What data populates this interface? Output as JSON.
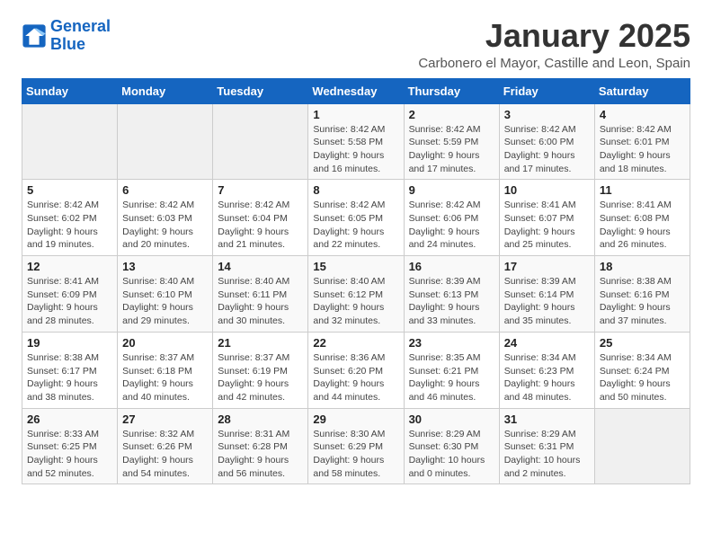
{
  "logo": {
    "line1": "General",
    "line2": "Blue"
  },
  "title": "January 2025",
  "subtitle": "Carbonero el Mayor, Castille and Leon, Spain",
  "weekdays": [
    "Sunday",
    "Monday",
    "Tuesday",
    "Wednesday",
    "Thursday",
    "Friday",
    "Saturday"
  ],
  "weeks": [
    [
      {
        "day": "",
        "detail": ""
      },
      {
        "day": "",
        "detail": ""
      },
      {
        "day": "",
        "detail": ""
      },
      {
        "day": "1",
        "detail": "Sunrise: 8:42 AM\nSunset: 5:58 PM\nDaylight: 9 hours and 16 minutes."
      },
      {
        "day": "2",
        "detail": "Sunrise: 8:42 AM\nSunset: 5:59 PM\nDaylight: 9 hours and 17 minutes."
      },
      {
        "day": "3",
        "detail": "Sunrise: 8:42 AM\nSunset: 6:00 PM\nDaylight: 9 hours and 17 minutes."
      },
      {
        "day": "4",
        "detail": "Sunrise: 8:42 AM\nSunset: 6:01 PM\nDaylight: 9 hours and 18 minutes."
      }
    ],
    [
      {
        "day": "5",
        "detail": "Sunrise: 8:42 AM\nSunset: 6:02 PM\nDaylight: 9 hours and 19 minutes."
      },
      {
        "day": "6",
        "detail": "Sunrise: 8:42 AM\nSunset: 6:03 PM\nDaylight: 9 hours and 20 minutes."
      },
      {
        "day": "7",
        "detail": "Sunrise: 8:42 AM\nSunset: 6:04 PM\nDaylight: 9 hours and 21 minutes."
      },
      {
        "day": "8",
        "detail": "Sunrise: 8:42 AM\nSunset: 6:05 PM\nDaylight: 9 hours and 22 minutes."
      },
      {
        "day": "9",
        "detail": "Sunrise: 8:42 AM\nSunset: 6:06 PM\nDaylight: 9 hours and 24 minutes."
      },
      {
        "day": "10",
        "detail": "Sunrise: 8:41 AM\nSunset: 6:07 PM\nDaylight: 9 hours and 25 minutes."
      },
      {
        "day": "11",
        "detail": "Sunrise: 8:41 AM\nSunset: 6:08 PM\nDaylight: 9 hours and 26 minutes."
      }
    ],
    [
      {
        "day": "12",
        "detail": "Sunrise: 8:41 AM\nSunset: 6:09 PM\nDaylight: 9 hours and 28 minutes."
      },
      {
        "day": "13",
        "detail": "Sunrise: 8:40 AM\nSunset: 6:10 PM\nDaylight: 9 hours and 29 minutes."
      },
      {
        "day": "14",
        "detail": "Sunrise: 8:40 AM\nSunset: 6:11 PM\nDaylight: 9 hours and 30 minutes."
      },
      {
        "day": "15",
        "detail": "Sunrise: 8:40 AM\nSunset: 6:12 PM\nDaylight: 9 hours and 32 minutes."
      },
      {
        "day": "16",
        "detail": "Sunrise: 8:39 AM\nSunset: 6:13 PM\nDaylight: 9 hours and 33 minutes."
      },
      {
        "day": "17",
        "detail": "Sunrise: 8:39 AM\nSunset: 6:14 PM\nDaylight: 9 hours and 35 minutes."
      },
      {
        "day": "18",
        "detail": "Sunrise: 8:38 AM\nSunset: 6:16 PM\nDaylight: 9 hours and 37 minutes."
      }
    ],
    [
      {
        "day": "19",
        "detail": "Sunrise: 8:38 AM\nSunset: 6:17 PM\nDaylight: 9 hours and 38 minutes."
      },
      {
        "day": "20",
        "detail": "Sunrise: 8:37 AM\nSunset: 6:18 PM\nDaylight: 9 hours and 40 minutes."
      },
      {
        "day": "21",
        "detail": "Sunrise: 8:37 AM\nSunset: 6:19 PM\nDaylight: 9 hours and 42 minutes."
      },
      {
        "day": "22",
        "detail": "Sunrise: 8:36 AM\nSunset: 6:20 PM\nDaylight: 9 hours and 44 minutes."
      },
      {
        "day": "23",
        "detail": "Sunrise: 8:35 AM\nSunset: 6:21 PM\nDaylight: 9 hours and 46 minutes."
      },
      {
        "day": "24",
        "detail": "Sunrise: 8:34 AM\nSunset: 6:23 PM\nDaylight: 9 hours and 48 minutes."
      },
      {
        "day": "25",
        "detail": "Sunrise: 8:34 AM\nSunset: 6:24 PM\nDaylight: 9 hours and 50 minutes."
      }
    ],
    [
      {
        "day": "26",
        "detail": "Sunrise: 8:33 AM\nSunset: 6:25 PM\nDaylight: 9 hours and 52 minutes."
      },
      {
        "day": "27",
        "detail": "Sunrise: 8:32 AM\nSunset: 6:26 PM\nDaylight: 9 hours and 54 minutes."
      },
      {
        "day": "28",
        "detail": "Sunrise: 8:31 AM\nSunset: 6:28 PM\nDaylight: 9 hours and 56 minutes."
      },
      {
        "day": "29",
        "detail": "Sunrise: 8:30 AM\nSunset: 6:29 PM\nDaylight: 9 hours and 58 minutes."
      },
      {
        "day": "30",
        "detail": "Sunrise: 8:29 AM\nSunset: 6:30 PM\nDaylight: 10 hours and 0 minutes."
      },
      {
        "day": "31",
        "detail": "Sunrise: 8:29 AM\nSunset: 6:31 PM\nDaylight: 10 hours and 2 minutes."
      },
      {
        "day": "",
        "detail": ""
      }
    ]
  ]
}
